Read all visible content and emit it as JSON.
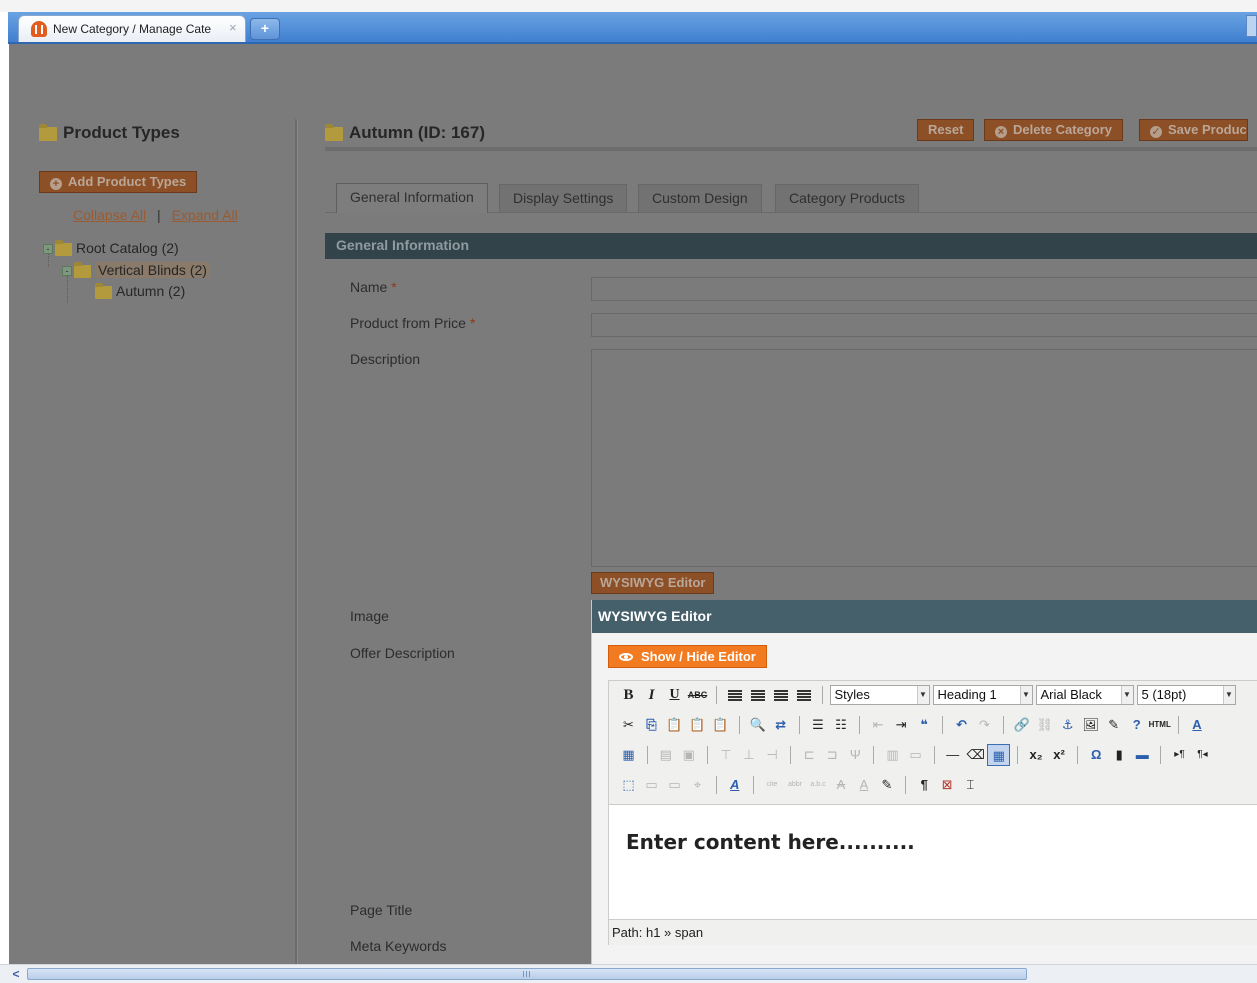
{
  "browser": {
    "tab_title": "New Category / Manage Cate",
    "tab_close": "×",
    "new_tab": "+"
  },
  "sidebar": {
    "heading": "Product Types",
    "add_button": "Add Product Types",
    "collapse_all": "Collapse All",
    "separator": "|",
    "expand_all": "Expand All",
    "tree": [
      {
        "label": "Root Catalog (2)"
      },
      {
        "label": "Vertical Blinds (2)"
      },
      {
        "label": "Autumn (2)"
      }
    ]
  },
  "header": {
    "title": "Autumn (ID: 167)",
    "reset": "Reset",
    "delete": "Delete Category",
    "save": "Save Produc"
  },
  "tabs": [
    "General Information",
    "Display Settings",
    "Custom Design",
    "Category Products"
  ],
  "form": {
    "section": "General Information",
    "name_label": "Name",
    "price_label": "Product from Price",
    "required_mark": "*",
    "description_label": "Description",
    "wysiwyg_button": "WYSIWYG Editor",
    "image_label": "Image",
    "offer_label": "Offer Description",
    "page_title_label": "Page Title",
    "meta_keywords_label": "Meta Keywords"
  },
  "dialog": {
    "title": "WYSIWYG Editor",
    "show_hide": "Show / Hide Editor",
    "styles_select": "Styles",
    "format_select": "Heading 1",
    "font_select": "Arial Black",
    "size_select": "5 (18pt)",
    "content": "Enter content here..........",
    "path_label": "Path:",
    "path_value": "h1 » span"
  }
}
